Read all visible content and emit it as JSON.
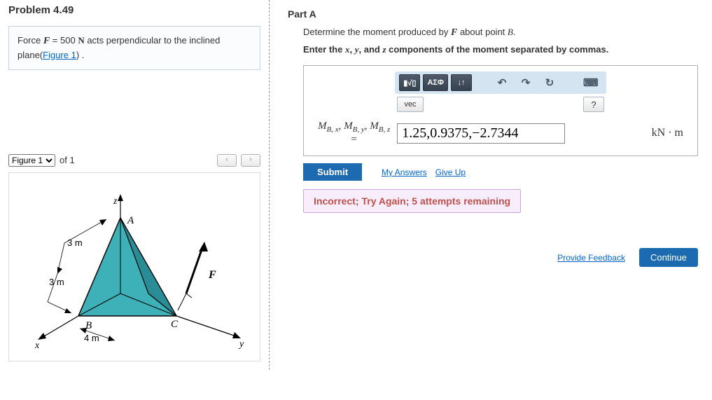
{
  "problem": {
    "title": "Problem 4.49",
    "statement_prefix": "Force ",
    "force_symbol": "F",
    "equals": " = 500 ",
    "force_unit": "N",
    "statement_suffix": " acts perpendicular to the inclined plane(",
    "figure_link_text": "Figure 1",
    "statement_end": ") ."
  },
  "figure": {
    "selector_value": "Figure 1",
    "of_text": "of 1",
    "labels": {
      "x": "x",
      "y": "y",
      "z": "z",
      "A": "A",
      "B": "B",
      "C": "C",
      "F": "F",
      "dim_top": "3 m",
      "dim_left": "3 m",
      "dim_bottom": "4 m"
    }
  },
  "partA": {
    "label": "Part A",
    "instruction_pre": "Determine the moment produced by ",
    "instruction_sym": "F",
    "instruction_mid": " about point ",
    "instruction_pt": "B",
    "instruction_end": ".",
    "instruction2_pre": "Enter the ",
    "instruction2_x": "x",
    "instruction2_c1": ", ",
    "instruction2_y": "y",
    "instruction2_c2": ", and ",
    "instruction2_z": "z",
    "instruction2_end": " components of the moment separated by commas."
  },
  "toolbar": {
    "template_label": "▮√▯",
    "greek_label": "ΑΣΦ",
    "arrows_label": "↓↑",
    "undo": "↶",
    "redo": "↷",
    "reset": "↻",
    "keyboard": "⌨",
    "vec_label": "vec",
    "help": "?"
  },
  "answer": {
    "lhs_html": "M_{B,x}, M_{B,y}, M_{B,z} =",
    "value": "1.25,0.9375,−2.7344",
    "units": "kN · m"
  },
  "actions": {
    "submit": "Submit",
    "my_answers": "My Answers",
    "give_up": "Give Up"
  },
  "feedback": "Incorrect; Try Again; 5 attempts remaining",
  "footer": {
    "provide_feedback": "Provide Feedback",
    "continue": "Continue"
  }
}
